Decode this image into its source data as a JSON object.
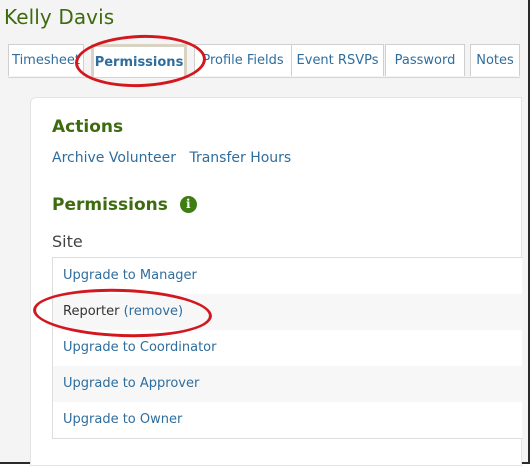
{
  "page": {
    "title": "Kelly Davis"
  },
  "tabs": [
    {
      "label": "Timesheet",
      "active": false
    },
    {
      "label": "Permissions",
      "active": true
    },
    {
      "label": "Profile Fields",
      "active": false
    },
    {
      "label": "Event RSVPs",
      "active": false
    },
    {
      "label": "Password",
      "active": false
    },
    {
      "label": "Notes",
      "active": false
    }
  ],
  "actions": {
    "heading": "Actions",
    "links": [
      "Archive Volunteer",
      "Transfer Hours"
    ]
  },
  "permissions": {
    "heading": "Permissions",
    "info_icon": "info-icon",
    "site_label": "Site",
    "rows": [
      {
        "link": "Upgrade to Manager"
      },
      {
        "text": "Reporter",
        "link": "(remove)"
      },
      {
        "link": "Upgrade to Coordinator"
      },
      {
        "link": "Upgrade to Approver"
      },
      {
        "link": "Upgrade to Owner"
      }
    ]
  },
  "colors": {
    "accent_green": "#3e6b10",
    "link_blue": "#2f6d9d",
    "highlight_red": "#d3171f"
  }
}
